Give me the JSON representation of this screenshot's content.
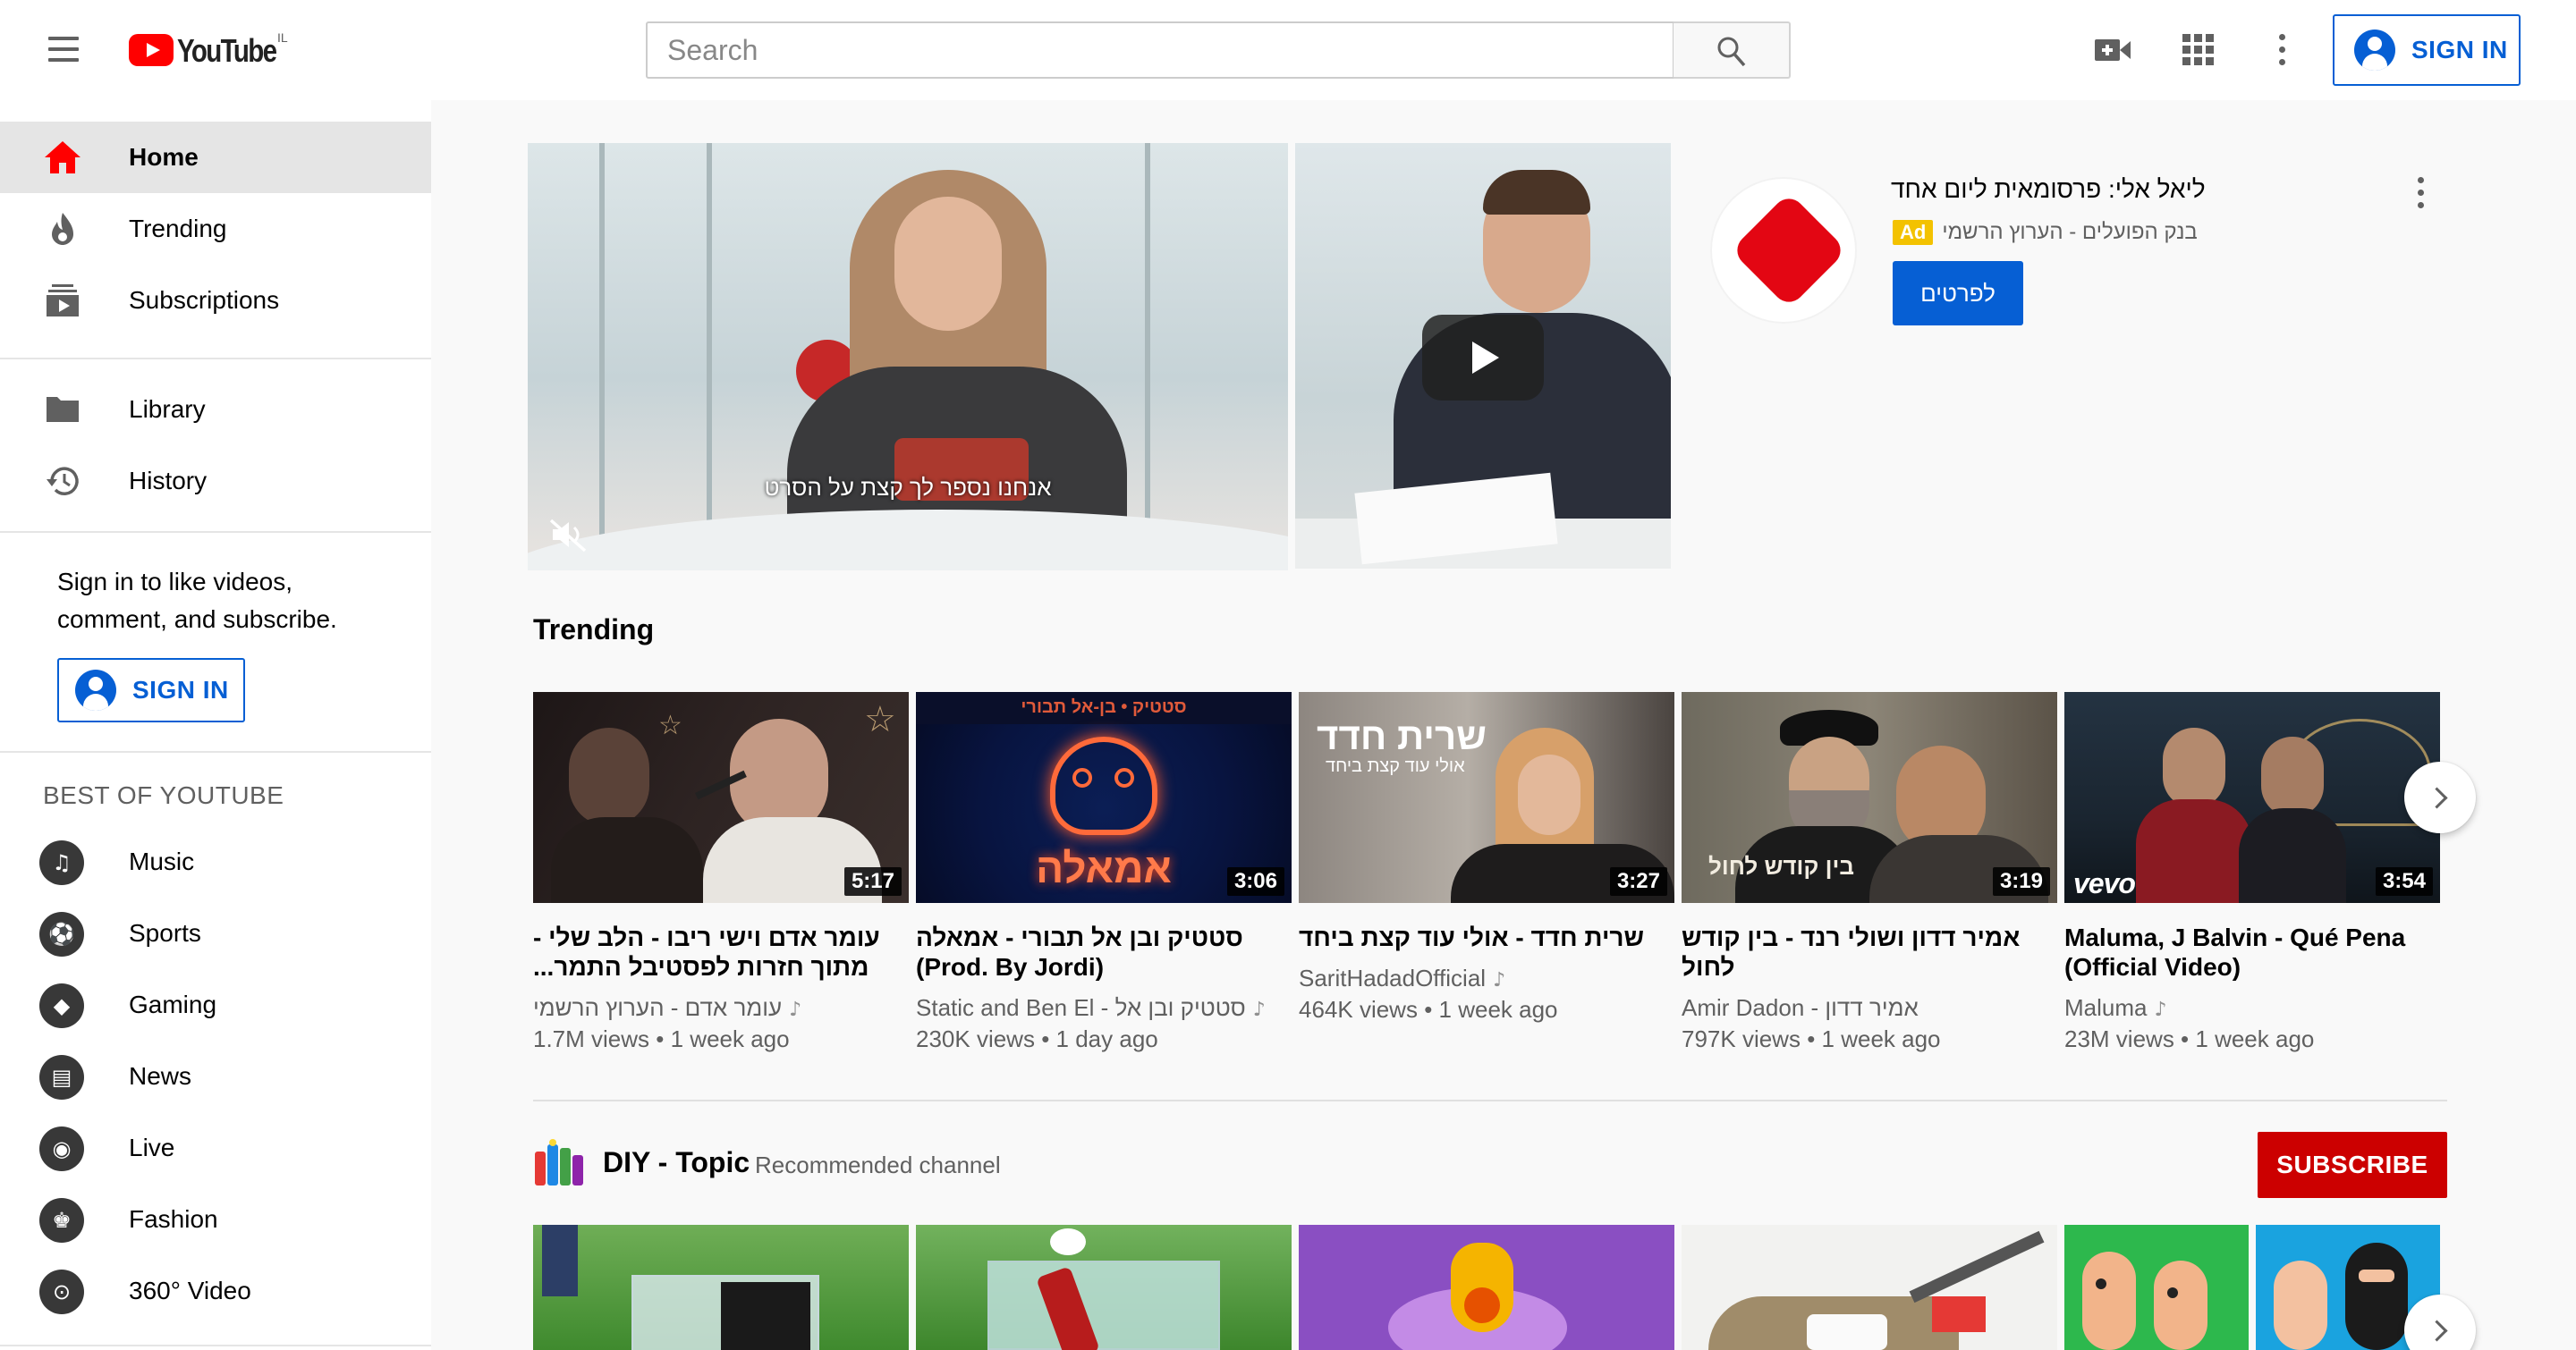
{
  "header": {
    "logo_text": "YouTube",
    "country_code": "IL",
    "search_placeholder": "Search",
    "sign_in_label": "SIGN IN"
  },
  "sidebar": {
    "primary": [
      {
        "label": "Home",
        "icon": "home-icon",
        "active": true
      },
      {
        "label": "Trending",
        "icon": "flame-icon"
      },
      {
        "label": "Subscriptions",
        "icon": "subscriptions-icon"
      }
    ],
    "secondary": [
      {
        "label": "Library",
        "icon": "folder-icon"
      },
      {
        "label": "History",
        "icon": "history-icon"
      }
    ],
    "sign_in_prompt": "Sign in to like videos, comment, and subscribe.",
    "sign_in_label": "SIGN IN",
    "best_heading": "BEST OF YOUTUBE",
    "best": [
      {
        "label": "Music",
        "icon": "music-icon"
      },
      {
        "label": "Sports",
        "icon": "sports-icon"
      },
      {
        "label": "Gaming",
        "icon": "gaming-icon"
      },
      {
        "label": "News",
        "icon": "news-icon"
      },
      {
        "label": "Live",
        "icon": "live-icon"
      },
      {
        "label": "Fashion",
        "icon": "fashion-icon"
      },
      {
        "label": "360° Video",
        "icon": "360-video-icon"
      }
    ]
  },
  "ad": {
    "subtitle": "אנחנו נספר לך קצת על הסרט",
    "title": "ליאל אלי: פרסומאית ליום אחד",
    "badge": "Ad",
    "channel": "בנק הפועלים - הערוץ הרשמי",
    "cta": "לפרטים"
  },
  "trending": {
    "title": "Trending",
    "videos": [
      {
        "title": "עומר אדם וישי ריבו - הלב שלי - מתוך חזרות לפסטיבל התמר...",
        "channel": "עומר אדם - הערוץ הרשמי",
        "views": "1.7M views",
        "age": "1 week ago",
        "duration": "5:17"
      },
      {
        "title": "סטטיק ובן אל תבורי - אמאלה (Prod. By Jordi)",
        "channel": "Static and Ben El - סטטיק ובן אל",
        "views": "230K views",
        "age": "1 day ago",
        "duration": "3:06"
      },
      {
        "title": "שרית חדד - אולי עוד קצת ביחד",
        "channel": "SaritHadadOfficial",
        "views": "464K views",
        "age": "1 week ago",
        "duration": "3:27"
      },
      {
        "title": "אמיר דדון ושולי רנד - בין קודש לחול",
        "channel": "Amir Dadon - אמיר דדון",
        "views": "797K views",
        "age": "1 week ago",
        "duration": "3:19"
      },
      {
        "title": "Maluma, J Balvin - Qué Pena (Official Video)",
        "channel": "Maluma",
        "views": "23M views",
        "age": "1 week ago",
        "duration": "3:54"
      }
    ]
  },
  "channel_shelf": {
    "name": "DIY - Topic",
    "subtitle": "Recommended channel",
    "subscribe_label": "SUBSCRIBE"
  },
  "thumb_text": {
    "t2_banner": "סטטיק • בן-אל תבורי",
    "t2_neon": "אמאלה",
    "t3_name": "שרית חדד",
    "t3_song": "אולי עוד קצת ביחד",
    "t4_song": "בין קודש לחול",
    "t5_brand": "vevo"
  },
  "colors": {
    "brand_red": "#ff0000",
    "link_blue": "#065fd4",
    "subscribe_red": "#cc0000",
    "ad_yellow": "#f3c200"
  }
}
